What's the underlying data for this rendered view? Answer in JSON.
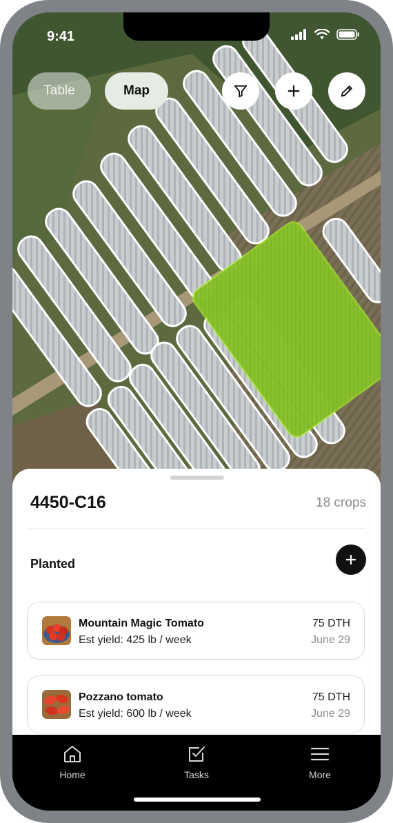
{
  "status_bar": {
    "time": "9:41"
  },
  "map_controls": {
    "table_label": "Table",
    "map_label": "Map",
    "selected_view": "Map",
    "icons": [
      "filter-icon",
      "plus-icon",
      "pencil-icon"
    ]
  },
  "field": {
    "name": "4450-C16",
    "crop_count": "18 crops",
    "highlight_color": "#8fd62a"
  },
  "planted": {
    "label": "Planted",
    "crops": [
      {
        "name": "Mountain Magic Tomato",
        "yield": "Est yield: 425 lb / week",
        "dth": "75 DTH",
        "date": "June 29",
        "icon": "tomato-bowl-image"
      },
      {
        "name": "Pozzano tomato",
        "yield": "Est yield: 600 lb / week",
        "dth": "75 DTH",
        "date": "June 29",
        "icon": "roma-tomato-image"
      }
    ]
  },
  "tab_bar": {
    "items": [
      {
        "label": "Home",
        "icon": "home-icon"
      },
      {
        "label": "Tasks",
        "icon": "tasks-icon"
      },
      {
        "label": "More",
        "icon": "menu-icon"
      }
    ]
  }
}
